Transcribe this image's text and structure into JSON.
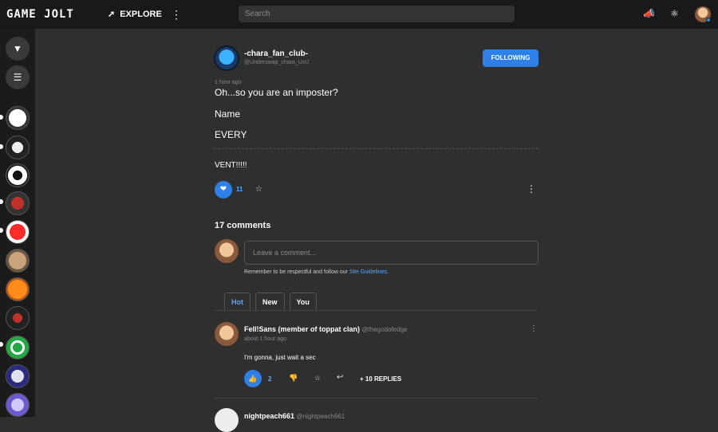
{
  "header": {
    "logo": "GAME JOLT",
    "explore_label": "EXPLORE",
    "search_placeholder": "Search"
  },
  "sidebar": {
    "games": [
      "game-1",
      "game-2",
      "game-3",
      "game-4",
      "game-5",
      "game-6",
      "game-7",
      "game-8",
      "game-9",
      "game-10",
      "game-11"
    ]
  },
  "post": {
    "author_name": "-chara_fan_club-",
    "author_handle": "@Underswap_chara_UvU",
    "follow_label": "FOLLOWING",
    "time": "1 hour ago",
    "lines": [
      "Oh...so you are an imposter?",
      "Name",
      "EVERY"
    ],
    "after_divider": "VENT!!!!!",
    "like_count": "11"
  },
  "comments": {
    "title": "17 comments",
    "input_placeholder": "Leave a comment...",
    "remember_text": "Remember to be respectful and follow our ",
    "guidelines_link": "Site Guidelines",
    "remember_end": ".",
    "tabs": [
      "Hot",
      "New",
      "You"
    ],
    "items": [
      {
        "author": "Fell!Sans (member of toppat clan)",
        "handle": "@thegodofedge",
        "time": "about 1 hour ago",
        "text": "I'm gonna, just wait a sec",
        "like_count": "2",
        "replies": "+ 10 REPLIES"
      },
      {
        "author": "nightpeach661",
        "handle": "@nightpeach661"
      }
    ]
  }
}
